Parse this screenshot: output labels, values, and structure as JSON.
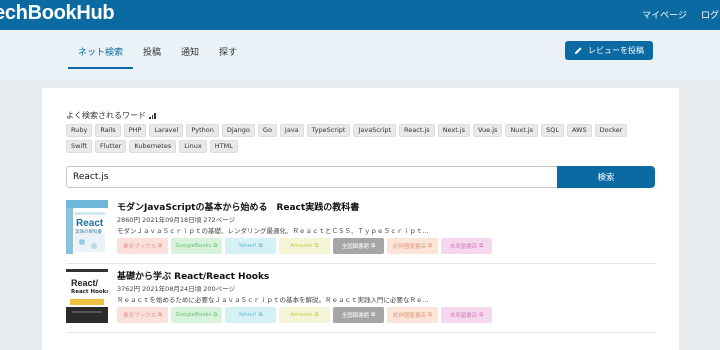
{
  "header": {
    "logo": "echBookHub",
    "nav": [
      "マイページ",
      "ログア"
    ]
  },
  "tabs": [
    {
      "label": "ネット検索",
      "active": true
    },
    {
      "label": "投稿",
      "active": false
    },
    {
      "label": "通知",
      "active": false
    },
    {
      "label": "探す",
      "active": false
    }
  ],
  "review_button": "レビューを投稿",
  "search": {
    "section_title": "よく検索されるワード",
    "tags": [
      "Ruby",
      "Rails",
      "PHP",
      "Laravel",
      "Python",
      "Django",
      "Go",
      "Java",
      "TypeScript",
      "JavaScript",
      "React.js",
      "Next.js",
      "Vue.js",
      "Nuxt.js",
      "SQL",
      "AWS",
      "Docker",
      "Swift",
      "Flutter",
      "Kubernetes",
      "Linux",
      "HTML"
    ],
    "query": "React.js",
    "button": "検索"
  },
  "link_styles": [
    {
      "bg": "#fbe0dc",
      "fg": "#e58b7f"
    },
    {
      "bg": "#d9f2dc",
      "fg": "#6fc17c"
    },
    {
      "bg": "#d6f1f5",
      "fg": "#5cbccd"
    },
    {
      "bg": "#f4f5d6",
      "fg": "#c5c75e"
    },
    {
      "bg": "#a5a5a5",
      "fg": "#ffffff"
    },
    {
      "bg": "#fbe4d8",
      "fg": "#e29a7a"
    },
    {
      "bg": "#f6d8ee",
      "fg": "#d57bbd"
    }
  ],
  "results": [
    {
      "title": "モダンJavaScriptの基本から始める　React実践の教科書",
      "meta": "2860円 2021年09月18日頃 272ページ",
      "desc": "モダンＪａｖａＳｃｒｉｐｔの基礎、レンダリング最適化、ＲｅａｃｔとＣＳＳ、ＴｙｐｅＳｃｒｉｐｔ...",
      "cover_main": "React",
      "cover_sub": "実践の教科書",
      "links": [
        "楽天ブックス",
        "GoogleBooks",
        "Yahoo!",
        "Amazon",
        "全国図書館",
        "紀伊國屋書店",
        "未来屋書店"
      ]
    },
    {
      "title": "基礎から学ぶ React/React Hooks",
      "meta": "3762円 2021年08月24日頃 200ページ",
      "desc": "Ｒｅａｃｔを始めるために必要なＪａｖａＳｃｒｉｐｔの基本を解説。Ｒｅａｃｔ実践入門に必要なＲｅ...",
      "cover_main": "React/",
      "cover_sub": "React Hooks",
      "links": [
        "楽天ブックス",
        "GoogleBooks",
        "Yahoo!",
        "Amazon",
        "全国図書館",
        "紀伊國屋書店",
        "未来屋書店"
      ]
    }
  ]
}
